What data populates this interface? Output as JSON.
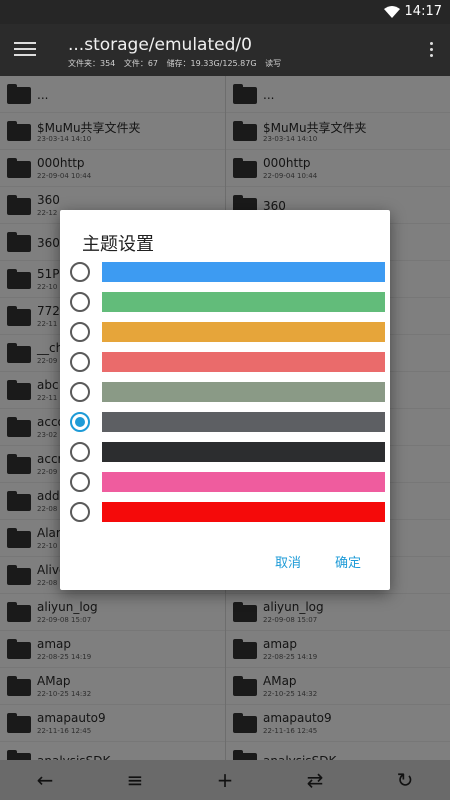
{
  "status": {
    "time": "14:17"
  },
  "header": {
    "title": "...storage/emulated/0",
    "subtitle": {
      "folders": "文件夹：354",
      "files": "文件：67",
      "storage": "储存：19.33G/125.87G",
      "mode": "读写"
    }
  },
  "files": [
    {
      "name": "...",
      "date": ""
    },
    {
      "name": "$MuMu共享文件夹",
      "date": "23-03-14 14:10"
    },
    {
      "name": "000http",
      "date": "22-09-04 10:44"
    },
    {
      "name": "360",
      "date": "22-12"
    },
    {
      "name": "360g",
      "date": ""
    },
    {
      "name": "51P",
      "date": "22-10"
    },
    {
      "name": "7723",
      "date": "22-11"
    },
    {
      "name": "__ch",
      "date": "22-09"
    },
    {
      "name": "abc",
      "date": "22-11"
    },
    {
      "name": "acco",
      "date": "23-02"
    },
    {
      "name": "accr",
      "date": "22-09"
    },
    {
      "name": "adda",
      "date": "22-08"
    },
    {
      "name": "Aları",
      "date": "22-10"
    },
    {
      "name": "Alivc",
      "date": "22-08"
    },
    {
      "name": "aliyun_log",
      "date": "22-09-08 15:07"
    },
    {
      "name": "amap",
      "date": "22-08-25 14:19"
    },
    {
      "name": "AMap",
      "date": "22-10-25 14:32"
    },
    {
      "name": "amapauto9",
      "date": "22-11-16 12:45"
    },
    {
      "name": "analysisSDK",
      "date": ""
    }
  ],
  "right_files": [
    {
      "name": "...",
      "date": ""
    },
    {
      "name": "$MuMu共享文件夹",
      "date": "23-03-14 14:10"
    },
    {
      "name": "000http",
      "date": "22-09-04 10:44"
    },
    {
      "name": "360",
      "date": ""
    },
    {
      "name": "",
      "date": ""
    },
    {
      "name": "",
      "date": ""
    },
    {
      "name": "",
      "date": ""
    },
    {
      "name": "",
      "date": ""
    },
    {
      "name": "",
      "date": ""
    },
    {
      "name": "",
      "date": ""
    },
    {
      "name": "",
      "date": ""
    },
    {
      "name": "",
      "date": ""
    },
    {
      "name": "",
      "date": ""
    },
    {
      "name": "",
      "date": ""
    },
    {
      "name": "aliyun_log",
      "date": "22-09-08 15:07"
    },
    {
      "name": "amap",
      "date": "22-08-25 14:19"
    },
    {
      "name": "AMap",
      "date": "22-10-25 14:32"
    },
    {
      "name": "amapauto9",
      "date": "22-11-16 12:45"
    },
    {
      "name": "analysisSDK",
      "date": ""
    }
  ],
  "dialog": {
    "title": "主题设置",
    "cancel": "取消",
    "ok": "确定",
    "themes": [
      "#3d9bf2",
      "#62bc7a",
      "#e6a53a",
      "#ea6b6b",
      "#8a9a86",
      "#5d5f63",
      "#2c2d2f",
      "#ef5c9e",
      "#f50a0a"
    ],
    "selected_index": 5
  },
  "bottom_bar": {
    "icons": [
      "back-arrow-icon",
      "list-icon",
      "add-icon",
      "swap-icon",
      "refresh-icon"
    ]
  }
}
